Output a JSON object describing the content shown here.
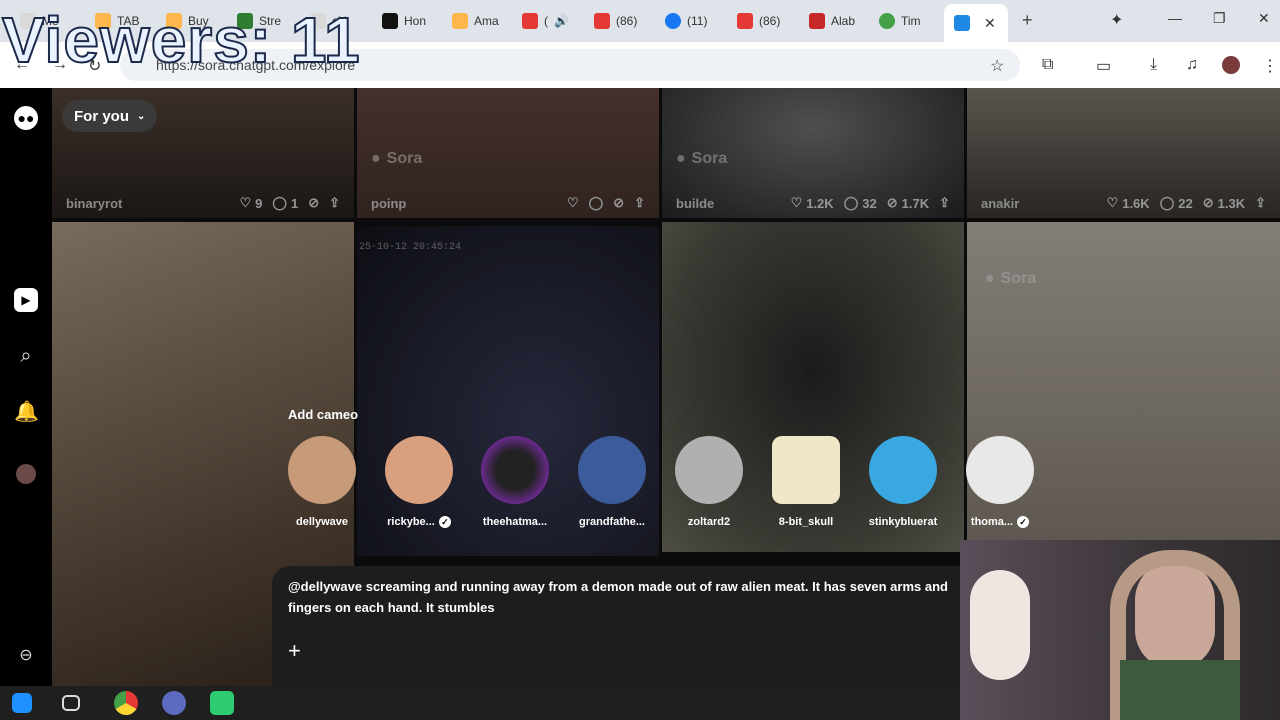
{
  "overlay": {
    "viewers": "Viewers: 11"
  },
  "browser": {
    "tabs": [
      {
        "label": "Me",
        "color": "#d9d9d9"
      },
      {
        "label": "TAB",
        "color": "#ffb74d"
      },
      {
        "label": "Buy",
        "color": "#ffb74d"
      },
      {
        "label": "Stre",
        "color": "#2e7d32"
      },
      {
        "label": "ckl",
        "color": "#d9d9d9"
      },
      {
        "label": "Hon",
        "color": "#111111"
      },
      {
        "label": "Ama",
        "color": "#ffb74d"
      },
      {
        "label": "(",
        "color": "#e53935"
      },
      {
        "label": "(86)",
        "color": "#e53935"
      },
      {
        "label": "(11)",
        "color": "#1877f2"
      },
      {
        "label": "(86)",
        "color": "#e53935"
      },
      {
        "label": "Alab",
        "color": "#c62828"
      },
      {
        "label": "Tim",
        "color": "#43a047"
      }
    ],
    "url": "https://sora.chatgpt.com/explore"
  },
  "feed": {
    "for_you": "For you",
    "top_tiles": [
      {
        "user": "binaryrot",
        "likes": "9",
        "comments": "1"
      },
      {
        "user": "poinp",
        "likes": "",
        "comments": ""
      },
      {
        "user": "builde",
        "likes": "1.2K",
        "comments": "32",
        "remixes": "1.7K"
      },
      {
        "user": "anakir",
        "likes": "1.6K",
        "comments": "22",
        "remixes": "1.3K"
      }
    ],
    "watermark": "Sora",
    "timestamp": "25-10-12 20:45:24"
  },
  "cameo": {
    "title": "Add cameo",
    "people": [
      {
        "name": "dellywave",
        "color": "#c79b7a",
        "verified": false
      },
      {
        "name": "rickybe...",
        "color": "#d9a07f",
        "verified": true
      },
      {
        "name": "theehatma...",
        "color": "#6a2a8c",
        "verified": false
      },
      {
        "name": "grandfathe...",
        "color": "#3b5b9b",
        "verified": false
      },
      {
        "name": "zoltard2",
        "color": "#b0b0b0",
        "verified": false
      },
      {
        "name": "8-bit_skull",
        "color": "#f0e6c8",
        "verified": false
      },
      {
        "name": "stinkybluerat",
        "color": "#39a7e0",
        "verified": false
      },
      {
        "name": "thoma...",
        "color": "#e8e8e8",
        "verified": true
      }
    ]
  },
  "composer": {
    "text": "@dellywave screaming and running away from a demon made out of raw alien meat.  It has seven arms and fingers on each hand.  It stumbles"
  }
}
